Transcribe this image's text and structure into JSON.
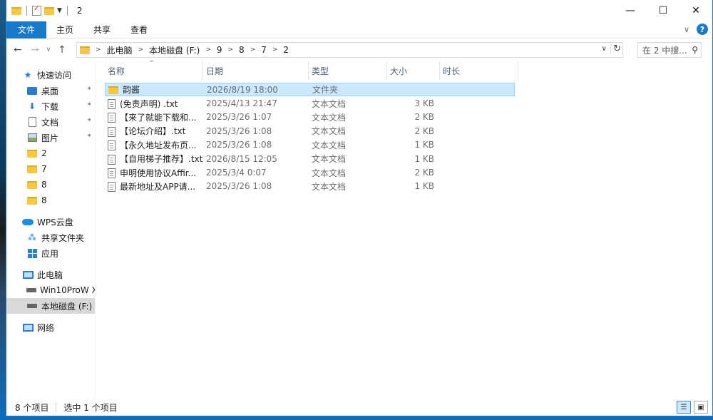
{
  "window": {
    "title": "2",
    "controls": {
      "minimize": "—",
      "maximize": "☐",
      "close": "✕"
    }
  },
  "ribbon": {
    "tabs": [
      "文件",
      "主页",
      "共享",
      "查看"
    ],
    "help": "?"
  },
  "address": {
    "crumbs": [
      "此电脑",
      "本地磁盘 (F:)",
      "9",
      "8",
      "7",
      "2"
    ],
    "search_placeholder": "在 2 中搜..."
  },
  "nav": {
    "quick_access": "快速访问",
    "pinned": [
      "桌面",
      "下载",
      "文档",
      "图片"
    ],
    "recent": [
      "2",
      "7",
      "8",
      "8"
    ],
    "wps": "WPS云盘",
    "wps_children": [
      "共享文件夹",
      "应用"
    ],
    "this_pc": "此电脑",
    "drives": [
      "Win10ProW X",
      "本地磁盘 (F:)"
    ],
    "network": "网络"
  },
  "columns": [
    "名称",
    "日期",
    "类型",
    "大小",
    "时长"
  ],
  "files": [
    {
      "name": "韵酱",
      "date": "2026/8/19 18:00",
      "type": "文件夹",
      "size": "",
      "kind": "folder",
      "selected": true
    },
    {
      "name": "(免责声明) .txt",
      "date": "2025/4/13 21:47",
      "type": "文本文档",
      "size": "3 KB",
      "kind": "file"
    },
    {
      "name": "【来了就能下载和...",
      "date": "2025/3/26 1:07",
      "type": "文本文档",
      "size": "2 KB",
      "kind": "file"
    },
    {
      "name": "【论坛介绍】.txt",
      "date": "2025/3/26 1:08",
      "type": "文本文档",
      "size": "2 KB",
      "kind": "file"
    },
    {
      "name": "【永久地址发布页...",
      "date": "2025/3/26 1:08",
      "type": "文本文档",
      "size": "1 KB",
      "kind": "file"
    },
    {
      "name": "【自用梯子推荐】.txt",
      "date": "2026/8/15 12:05",
      "type": "文本文档",
      "size": "1 KB",
      "kind": "file"
    },
    {
      "name": "申明使用协议Affir...",
      "date": "2025/3/4 0:07",
      "type": "文本文档",
      "size": "2 KB",
      "kind": "file"
    },
    {
      "name": "最新地址及APP请...",
      "date": "2025/3/26 1:08",
      "type": "文本文档",
      "size": "1 KB",
      "kind": "file"
    }
  ],
  "status": {
    "count": "8 个项目",
    "selection": "选中 1 个项目"
  },
  "colors": {
    "accent": "#1979ca",
    "selected_row": "#cce8ff",
    "folder": "#f5c842"
  }
}
